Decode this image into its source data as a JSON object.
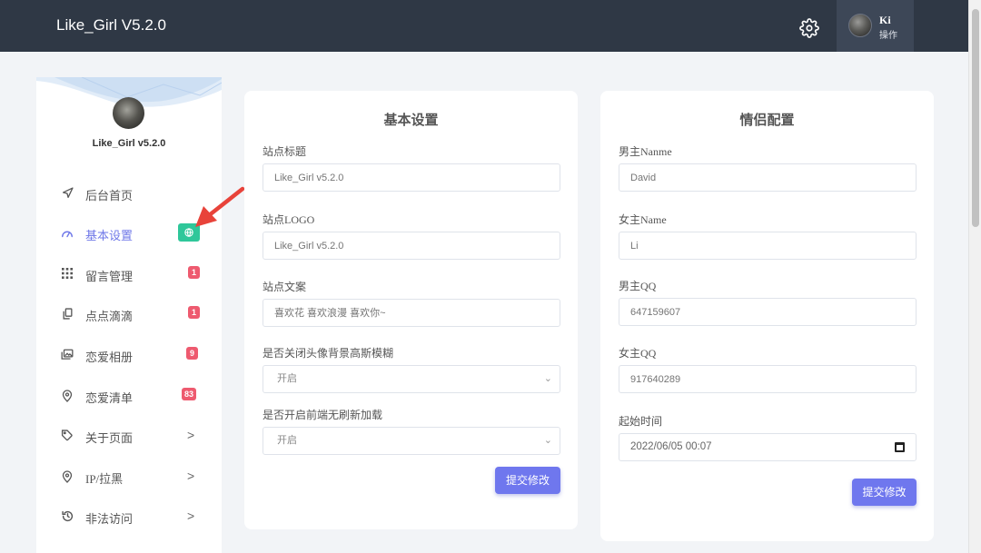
{
  "header": {
    "brand": "Like_Girl V5.2.0",
    "user_name": "Ki",
    "user_action": "操作",
    "settings_icon": "gear-icon"
  },
  "sidebar": {
    "site_name": "Like_Girl v5.2.0",
    "items": [
      {
        "label": "后台首页",
        "icon": "navigation-icon"
      },
      {
        "label": "基本设置",
        "icon": "speedometer-icon",
        "active": true,
        "badge_icon": "globe-icon"
      },
      {
        "label": "留言管理",
        "icon": "grid-icon",
        "badge": "1"
      },
      {
        "label": "点点滴滴",
        "icon": "copy-icon",
        "badge": "1"
      },
      {
        "label": "恋爱相册",
        "icon": "photos-icon",
        "badge": "9"
      },
      {
        "label": "恋爱清单",
        "icon": "location-icon",
        "badge": "83"
      },
      {
        "label": "关于页面",
        "icon": "tag-icon",
        "chevron": ">"
      },
      {
        "label": "IP/拉黑",
        "icon": "location-icon",
        "chevron": ">"
      },
      {
        "label": "非法访问",
        "icon": "history-icon",
        "chevron": ">"
      }
    ]
  },
  "basic_settings": {
    "title": "基本设置",
    "site_title_label": "站点标题",
    "site_title_placeholder": "Like_Girl v5.2.0",
    "site_logo_label": "站点LOGO",
    "site_logo_placeholder": "Like_Girl v5.2.0",
    "site_copy_label": "站点文案",
    "site_copy_placeholder": "喜欢花 喜欢浪漫 喜欢你~",
    "blur_label": "是否关闭头像背景高斯模糊",
    "blur_value": "开启",
    "refresh_label": "是否开启前端无刷新加载",
    "refresh_value": "开启",
    "submit": "提交修改"
  },
  "couple_settings": {
    "title": "情侣配置",
    "male_name_label": "男主Nanme",
    "male_name_placeholder": "David",
    "female_name_label": "女主Name",
    "female_name_placeholder": "Li",
    "male_qq_label": "男主QQ",
    "male_qq_placeholder": "647159607",
    "female_qq_label": "女主QQ",
    "female_qq_placeholder": "917640289",
    "start_time_label": "起始时间",
    "start_time_value": "2022/06/05 00:07",
    "submit": "提交修改"
  },
  "colors": {
    "topbar": "#2f3845",
    "accent": "#6f77ee",
    "badge_red": "#ee5a6f",
    "badge_green": "#2fc79a",
    "annotation_arrow": "#e8433a"
  }
}
